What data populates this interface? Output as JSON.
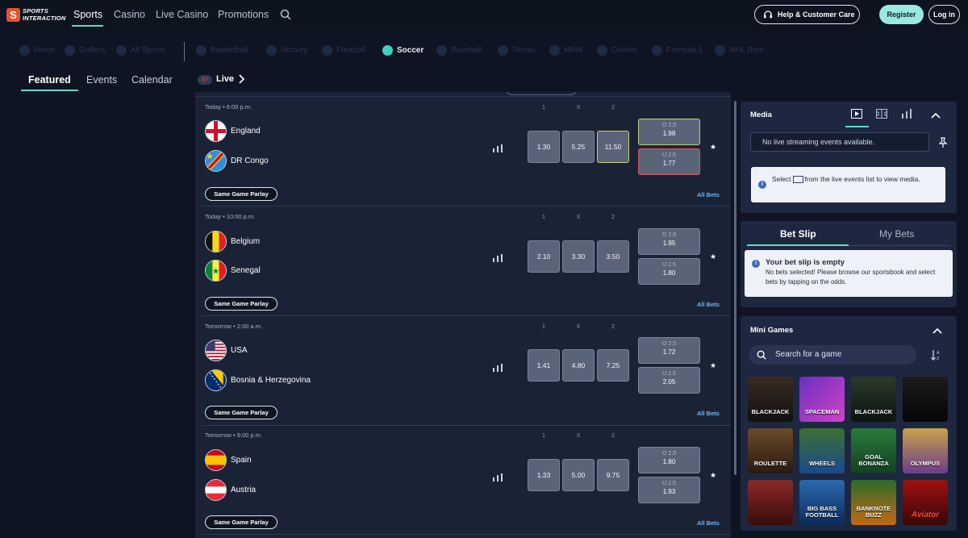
{
  "brand": {
    "logo_mark": "S",
    "logo_text": "SPORTS INTERACTION"
  },
  "topnav": {
    "links": [
      "Sports",
      "Casino",
      "Live Casino",
      "Promotions"
    ],
    "active": "Sports",
    "help_label": "Help & Customer Care",
    "register_label": "Register",
    "login_label": "Log in"
  },
  "sports": [
    {
      "label": "Home"
    },
    {
      "label": "Golfers"
    },
    {
      "label": "All Sports"
    },
    {
      "label": "Basketball"
    },
    {
      "label": "Hockey"
    },
    {
      "label": "Football"
    },
    {
      "label": "Soccer",
      "active": true
    },
    {
      "label": "Baseball"
    },
    {
      "label": "Tennis"
    },
    {
      "label": "MMA"
    },
    {
      "label": "Cricket"
    },
    {
      "label": "Formula 1"
    },
    {
      "label": "NHL Bets"
    }
  ],
  "subtabs": {
    "featured": "Featured",
    "events": "Events",
    "calendar": "Calendar",
    "live_count": "37",
    "live_label": "Live"
  },
  "columns": {
    "home": "1",
    "draw": "X",
    "away": "2"
  },
  "matches": [
    {
      "time": "Today • 6:00 p.m.",
      "home": "England",
      "away": "DR Congo",
      "odds": [
        "1.30",
        "5.25",
        "11.50"
      ],
      "over_label": "O 2.5",
      "over": "1.98",
      "under_label": "U 2.5",
      "under": "1.77",
      "sgp": "Same Game Parlay",
      "all_bets": "All Bets"
    },
    {
      "time": "Today • 10:00 p.m.",
      "home": "Belgium",
      "away": "Senegal",
      "odds": [
        "2.10",
        "3.30",
        "3.50"
      ],
      "over_label": "O 2.5",
      "over": "1.95",
      "under_label": "U 2.5",
      "under": "1.80",
      "sgp": "Same Game Parlay",
      "all_bets": "All Bets"
    },
    {
      "time": "Tomorrow • 2:00 a.m.",
      "home": "USA",
      "away": "Bosnia & Herzegovina",
      "odds": [
        "1.41",
        "4.80",
        "7.25"
      ],
      "over_label": "O 2.5",
      "over": "1.72",
      "under_label": "U 2.5",
      "under": "2.05",
      "sgp": "Same Game Parlay",
      "all_bets": "All Bets"
    },
    {
      "time": "Tomorrow • 9:00 p.m.",
      "home": "Spain",
      "away": "Austria",
      "odds": [
        "1.33",
        "5.00",
        "9.75"
      ],
      "over_label": "O 2.5",
      "over": "1.80",
      "under_label": "U 2.5",
      "under": "1.93",
      "sgp": "Same Game Parlay",
      "all_bets": "All Bets"
    }
  ],
  "media": {
    "title": "Media",
    "no_stream": "No live streaming events available.",
    "info_pre": "Select",
    "info_post": "from the live events list to view media."
  },
  "betslip": {
    "tab_betslip": "Bet Slip",
    "tab_mybets": "My Bets",
    "empty_title": "Your bet slip is empty",
    "empty_body": "No bets selected! Please browse our sportsbook and select bets by tapping on the odds."
  },
  "mini_games": {
    "title": "Mini Games",
    "search_placeholder": "Search for a game",
    "games": [
      "BLACKJACK",
      "SPACEMAN",
      "BLACKJACK",
      "",
      "ROULETTE",
      "WHEELS",
      "GOAL BONANZA",
      "OLYMPUS",
      "",
      "BIG BASS FOOTBALL",
      "BANKNOTE BUZZ",
      "Aviator"
    ]
  },
  "colors": {
    "accent": "#5fd9c6",
    "brand": "#e4532e",
    "link": "#6fb6f2"
  }
}
